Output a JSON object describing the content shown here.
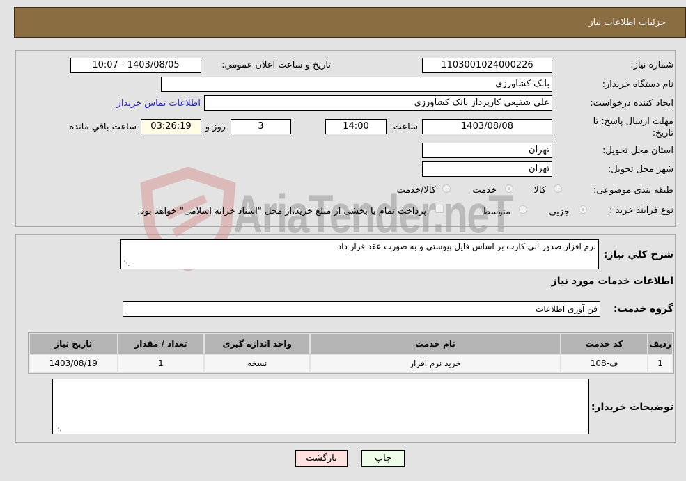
{
  "header": {
    "title": "جزئیات اطلاعات نیاز"
  },
  "details": {
    "need_number_label": "شماره نیاز:",
    "need_number": "1103001024000226",
    "announce_label": "تاریخ و ساعت اعلان عمومي:",
    "announce_value": "1403/08/05 - 10:07",
    "buyer_org_label": "نام دستگاه خريدار:",
    "buyer_org": "بانک کشاورزی",
    "creator_label": "ایجاد کننده درخواست:",
    "creator": "علی شفیعی کارپرداز بانک کشاورزی",
    "contact_link": "اطلاعات تماس خريدار",
    "deadline_label": "مهلت ارسال پاسخ: تا تاریخ:",
    "deadline_date": "1403/08/08",
    "time_label": "ساعت",
    "deadline_time": "14:00",
    "days_value": "3",
    "days_label": "روز و",
    "remaining_time": "03:26:19",
    "remaining_label": "ساعت باقي مانده",
    "province_label": "استان محل تحویل:",
    "province": "تهران",
    "city_label": "شهر محل تحویل:",
    "city": "تهران",
    "category_label": "طبقه بندی موضوعی:",
    "category_options": [
      {
        "label": "کالا",
        "checked": false
      },
      {
        "label": "خدمت",
        "checked": true
      },
      {
        "label": "کالا/خدمت",
        "checked": false
      }
    ],
    "process_label": "نوع فرآیند خرید :",
    "process_options": [
      {
        "label": "جزيي",
        "checked": true
      },
      {
        "label": "متوسط",
        "checked": false
      }
    ],
    "treasury_note": "پرداخت تمام یا بخشی از مبلغ خرید،از محل \"اسناد خزانه اسلامی\" خواهد بود."
  },
  "description": {
    "label": "شرح کلي نياز:",
    "value": "نرم افزار صدور آنی کارت بر اساس فایل پیوستی و به صورت عقد قرار داد"
  },
  "services": {
    "section_title": "اطلاعات خدمات مورد نیاز",
    "group_label": "گروه خدمت:",
    "group_value": "فن آوری اطلاعات",
    "columns": [
      "ردیف",
      "کد خدمت",
      "نام خدمت",
      "واحد اندازه گیری",
      "تعداد / مقدار",
      "تاریخ نیاز"
    ],
    "rows": [
      [
        "1",
        "ف-108",
        "خرید نرم افزار",
        "نسخه",
        "1",
        "1403/08/19"
      ]
    ]
  },
  "buyer_notes": {
    "label": "توضیحات خریدار:",
    "value": ""
  },
  "buttons": {
    "print": "چاپ",
    "back": "بازگشت"
  },
  "watermark": {
    "text": "AriaTender.neT"
  }
}
